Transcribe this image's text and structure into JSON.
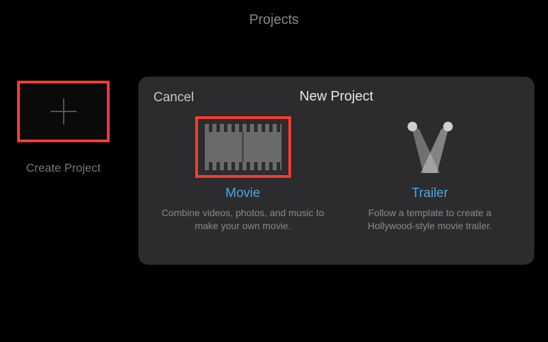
{
  "header": {
    "title": "Projects"
  },
  "sidebar": {
    "create_label": "Create Project"
  },
  "modal": {
    "cancel_label": "Cancel",
    "title": "New Project",
    "options": {
      "movie": {
        "label": "Movie",
        "description": "Combine videos, photos, and music to make your own movie."
      },
      "trailer": {
        "label": "Trailer",
        "description": "Follow a template to create a Hollywood-style movie trailer."
      }
    }
  }
}
